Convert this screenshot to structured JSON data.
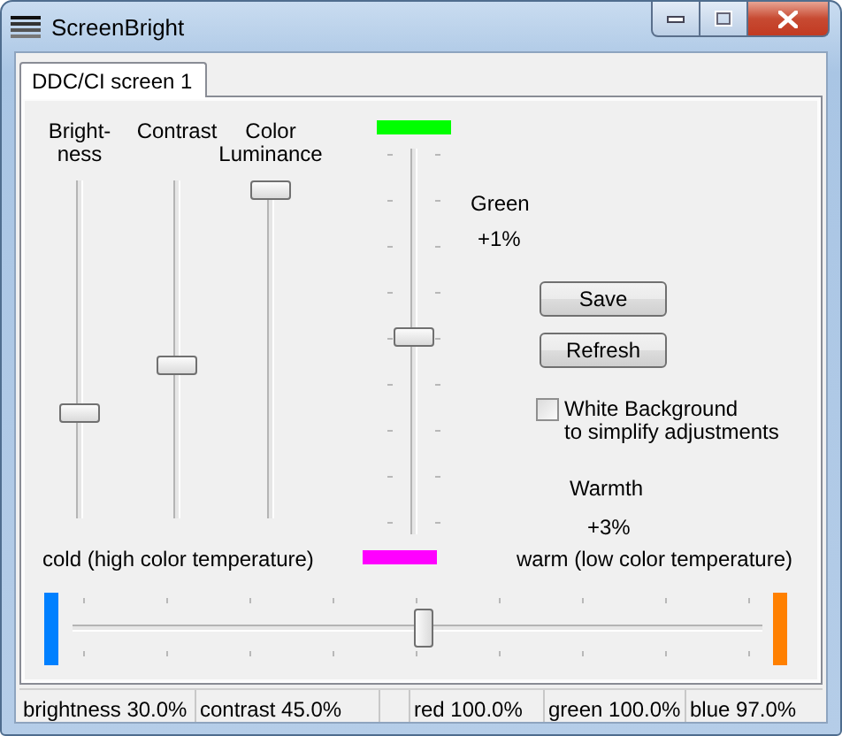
{
  "window": {
    "title": "ScreenBright"
  },
  "tabs": [
    {
      "label": "DDC/CI screen 1",
      "selected": true
    }
  ],
  "sliders": [
    {
      "label": "Bright-\nness",
      "level": 0.3
    },
    {
      "label": "Contrast",
      "level": 0.45
    },
    {
      "label": "Color\nLuminance",
      "level": 1
    }
  ],
  "tint": {
    "label": "Green",
    "reading": "+1%",
    "level": 0.51,
    "ends": [
      {
        "color": "#00ff00"
      },
      {
        "color": "#ff00ff"
      }
    ]
  },
  "buttons": [
    "Save",
    "Refresh"
  ],
  "white_background": {
    "label": "White Background\nto simplify adjustments",
    "checked": false
  },
  "warmth": {
    "label": "Warmth",
    "reading": "+3%",
    "cold_label": "cold (high color temperature)",
    "warm_label": "warm (low color temperature)",
    "level": 0.51,
    "ends": [
      {
        "color": "#0080ff"
      },
      {
        "color": "#ff8000"
      }
    ]
  },
  "status_bar": [
    {
      "text": "brightness 30.0%"
    },
    {
      "text": "contrast 45.0%"
    },
    {
      "text": "red 100.0%"
    },
    {
      "text": "green 100.0%"
    },
    {
      "text": "blue 97.0%"
    }
  ]
}
